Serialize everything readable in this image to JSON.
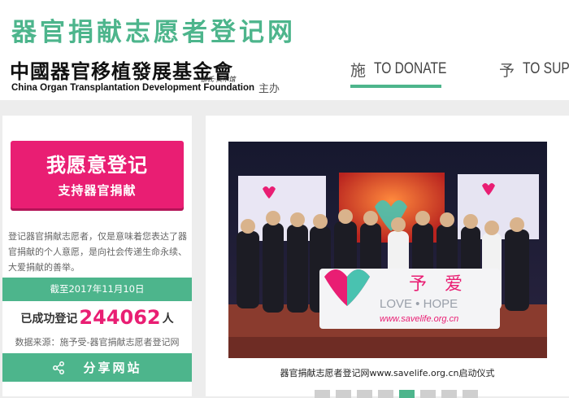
{
  "header": {
    "site_title": "器官捐献志愿者登记网",
    "logo_cn": "中國器官移植發展基金會",
    "logo_en": "China Organ Transplantation Development Foundation",
    "logo_signature": "邵氏·美术馆",
    "host_label": "主办"
  },
  "nav": [
    {
      "cn": "施",
      "en": "TO DONATE",
      "active": true
    },
    {
      "cn": "予",
      "en": "TO SUPP",
      "active": false
    }
  ],
  "sidebar": {
    "register_button_line1": "我愿意登记",
    "register_button_line2": "支持器官捐献",
    "description": "登记器官捐献志愿者，仅是意味着您表达了器官捐献的个人意愿，是向社会传递生命永续、大爱捐献的善举。",
    "as_of_date": "截至2017年11月10日",
    "registered_label": "已成功登记",
    "registered_count": "244062",
    "registered_unit": "人",
    "data_source": "数据来源：施予受-器官捐献志愿者登记网",
    "share_label": "分享网站"
  },
  "slideshow": {
    "caption": "器官捐献志愿者登记网www.savelife.org.cn启动仪式",
    "podium_text_1": "予",
    "podium_text_2": "爱",
    "podium_text_3": "LOVE • HOPE",
    "podium_url": "www.savelife.org.cn",
    "dot_count": 8,
    "active_dot": 4
  },
  "colors": {
    "brand_green": "#4db58c",
    "register_pink": "#e91e73"
  }
}
